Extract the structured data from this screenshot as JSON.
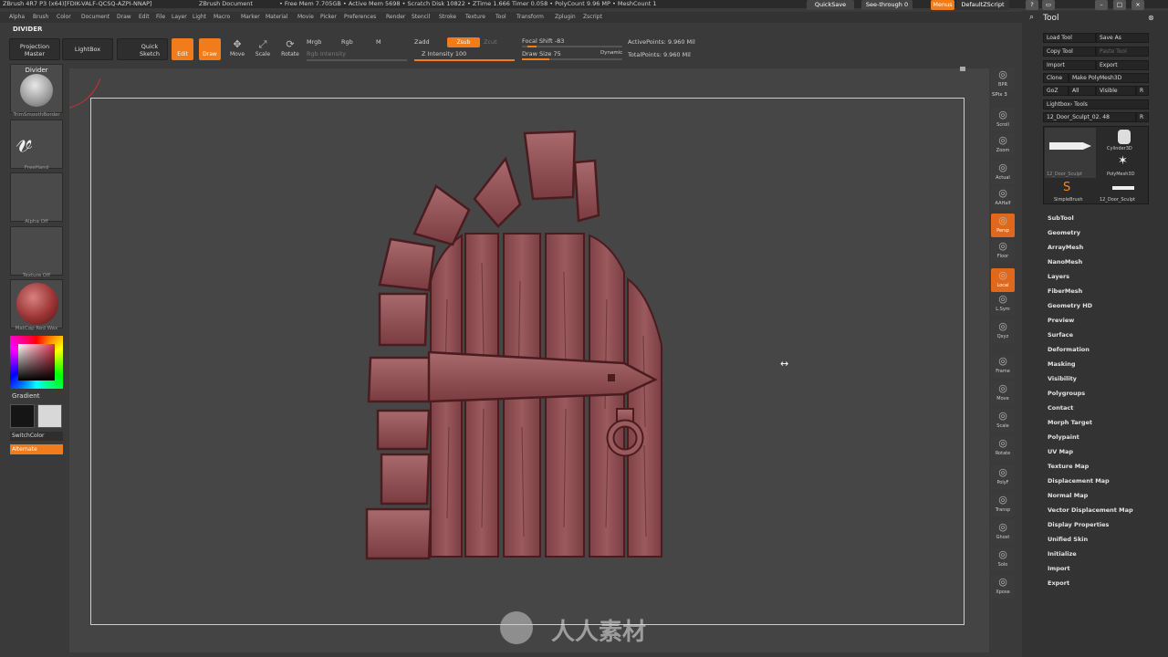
{
  "titlebar": {
    "app": "ZBrush 4R7 P3 (x64)[FDIK-VALF-QCSQ-AZPI-NNAP]",
    "doc": "ZBrush Document",
    "stats": "• Free Mem 7.705GB • Active Mem 5698 • Scratch Disk 10822 • ZTime 1.666 Timer 0.058 • PolyCount 9.96 MP • MeshCount 1",
    "quicksave": "QuickSave",
    "see_through": "See-through 0",
    "menus": "Menus",
    "script": "DefaultZScript"
  },
  "menubar": [
    "Alpha",
    "Brush",
    "Color",
    "Document",
    "Draw",
    "Edit",
    "File",
    "Layer",
    "Light",
    "Macro",
    "Marker",
    "Material",
    "Movie",
    "Picker",
    "Preferences",
    "Render",
    "Stencil",
    "Stroke",
    "Texture",
    "Tool",
    "Transform",
    "Zplugin",
    "Zscript"
  ],
  "divider_label": "DIVIDER",
  "toolbar": {
    "projection_master": "Projection Master",
    "lightbox": "LightBox",
    "quick_sketch": "Quick Sketch",
    "edit": "Edit",
    "draw": "Draw",
    "move": "Move",
    "scale": "Scale",
    "rotate": "Rotate",
    "mrgb": "Mrgb",
    "rgb": "Rgb",
    "m": "M",
    "rgb_intensity": "Rgb Intensity",
    "zadd": "Zadd",
    "zsub": "Zsub",
    "zcut": "Zcut",
    "z_intensity": "Z Intensity 100",
    "focal_shift": "Focal Shift -83",
    "draw_size": "Draw Size 75",
    "dynamic": "Dynamic",
    "active_points": "ActivePoints: 9.960 Mil",
    "total_points": "TotalPoints: 9.960 Mil"
  },
  "left_shelf": {
    "brush_name": "Divider",
    "brush_caption": "TrimSmoothBorder",
    "stroke_caption": "FreeHand",
    "alpha_caption": "Alpha Off",
    "texture_caption": "Texture Off",
    "material_caption": "MatCap Red Wax",
    "gradient": "Gradient",
    "switchcolor": "SwitchColor",
    "alternate": "Alternate"
  },
  "right_dock": [
    "BPR",
    "SPix 3",
    "Scroll",
    "Zoom",
    "Actual",
    "AAHalf",
    "Persp",
    "Floor",
    "Local",
    "L.Sym",
    "Qxyz",
    "Frame",
    "Move",
    "Scale",
    "Rotate",
    "PolyF",
    "Transp",
    "Ghost",
    "Solo",
    "Xpose"
  ],
  "tool_panel": {
    "title": "Tool",
    "load_tool": "Load Tool",
    "save_as": "Save As",
    "copy_tool": "Copy Tool",
    "paste_tool": "Paste Tool",
    "import": "Import",
    "export": "Export",
    "clone": "Clone",
    "make_polymesh": "Make PolyMesh3D",
    "goz": "GoZ",
    "all": "All",
    "visible": "Visible",
    "r": "R",
    "lightbox_tools": "Lightbox› Tools",
    "current_tool": "12_Door_Sculpt_02. 48",
    "thumbs": [
      "12_Door_Sculpt",
      "Cylinder3D",
      "PolyMesh3D",
      "SimpleBrush",
      "12_Door_Sculpt"
    ],
    "subpalettes": [
      "SubTool",
      "Geometry",
      "ArrayMesh",
      "NanoMesh",
      "Layers",
      "FiberMesh",
      "Geometry HD",
      "Preview",
      "Surface",
      "Deformation",
      "Masking",
      "Visibility",
      "Polygroups",
      "Contact",
      "Morph Target",
      "Polypaint",
      "UV Map",
      "Texture Map",
      "Displacement Map",
      "Normal Map",
      "Vector Displacement Map",
      "Display Properties",
      "Unified Skin",
      "Initialize",
      "Import",
      "Export"
    ]
  },
  "watermark": "人人素材",
  "colors": {
    "accent": "#f07c1b",
    "door": "#8a4a4e"
  }
}
